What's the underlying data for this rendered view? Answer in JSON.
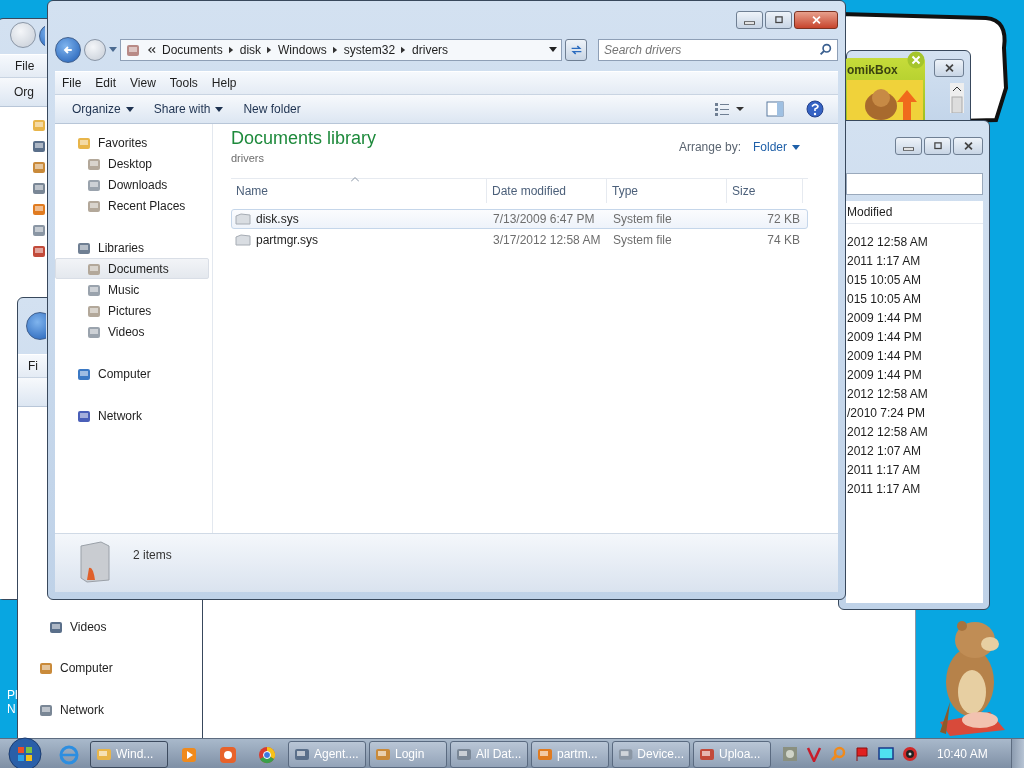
{
  "back_window_left": {
    "menu": "File",
    "toolbar": "Org"
  },
  "back_window_lower": {
    "menu": "Fi",
    "nav": [
      "Videos",
      "Computer",
      "Network"
    ]
  },
  "desktop_icons": [
    "Pl",
    "N"
  ],
  "popup": {
    "title": "omikBox"
  },
  "back_window_right": {
    "column": "Modified",
    "dates": [
      "2012 12:58 AM",
      "2011 1:17 AM",
      "015 10:05 AM",
      "015 10:05 AM",
      "2009 1:44 PM",
      "2009 1:44 PM",
      "2009 1:44 PM",
      "2009 1:44 PM",
      "2012 12:58 AM",
      "/2010 7:24 PM",
      "2012 12:58 AM",
      "2012 1:07 AM",
      "2011 1:17 AM",
      "2011 1:17 AM"
    ]
  },
  "main_window": {
    "address": [
      "Documents",
      "disk",
      "Windows",
      "system32",
      "drivers"
    ],
    "search": {
      "placeholder": "Search drivers"
    },
    "menu": [
      "File",
      "Edit",
      "View",
      "Tools",
      "Help"
    ],
    "toolbar": [
      {
        "label": "Organize",
        "kind": "dropdown"
      },
      {
        "label": "Share with",
        "kind": "dropdown"
      },
      {
        "label": "New folder",
        "kind": "plain"
      }
    ],
    "nav": [
      {
        "label": "Favorites",
        "selected": false,
        "children": [
          {
            "label": "Desktop",
            "selected": false
          },
          {
            "label": "Downloads",
            "selected": false
          },
          {
            "label": "Recent Places",
            "selected": false
          }
        ]
      },
      {
        "label": "Libraries",
        "selected": false,
        "children": [
          {
            "label": "Documents",
            "selected": true
          },
          {
            "label": "Music",
            "selected": false
          },
          {
            "label": "Pictures",
            "selected": false
          },
          {
            "label": "Videos",
            "selected": false
          }
        ]
      },
      {
        "label": "Computer",
        "selected": false
      },
      {
        "label": "Network",
        "selected": false
      }
    ],
    "library": {
      "title": "Documents library",
      "subtitle": "drivers",
      "arrange_label": "Arrange by:",
      "arrange_value": "Folder"
    },
    "columns": [
      "Name",
      "Date modified",
      "Type",
      "Size"
    ],
    "files": [
      {
        "name": "disk.sys",
        "date": "7/13/2009 6:47 PM",
        "type": "System file",
        "size": "72 KB",
        "hovered": true
      },
      {
        "name": "partmgr.sys",
        "date": "3/17/2012 12:58 AM",
        "type": "System file",
        "size": "74 KB",
        "hovered": false
      }
    ],
    "status": "2 items"
  },
  "taskbar": {
    "windows": [
      {
        "label": "Wind...",
        "active": true
      },
      {
        "label": "Agent....",
        "active": false
      },
      {
        "label": "Login",
        "active": false
      },
      {
        "label": "All Dat...",
        "active": false
      },
      {
        "label": "partm...",
        "active": false
      },
      {
        "label": "Device...",
        "active": false
      },
      {
        "label": "Uploa...",
        "active": false
      }
    ],
    "clock": "10:40 AM"
  }
}
